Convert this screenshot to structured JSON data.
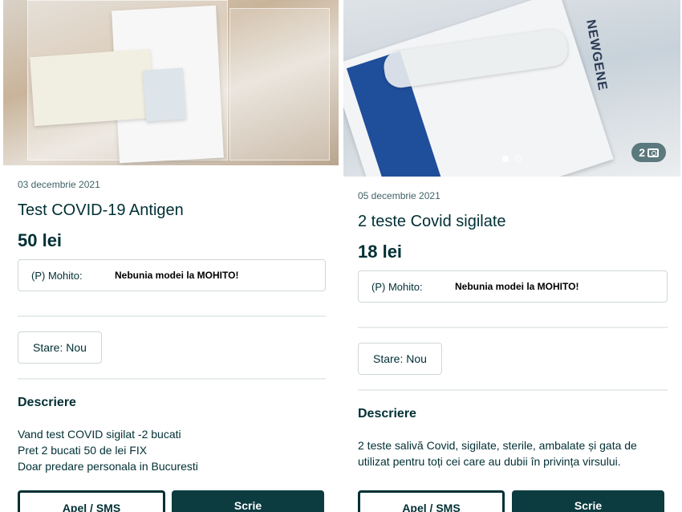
{
  "listings": [
    {
      "date": "03 decembrie 2021",
      "title": "Test COVID-19 Antigen",
      "price": "50 lei",
      "promo": {
        "label": "(P) Mohito:",
        "text": "Nebunia modei la MOHITO!"
      },
      "condition": "Stare: Nou",
      "description_title": "Descriere",
      "description_lines": [
        "Vand test COVID sigilat -2 bucati",
        "Pret 2 bucati 50 de lei FIX",
        "Doar predare personala in Bucuresti"
      ],
      "buttons": {
        "call": "Apel / SMS",
        "chat": "Scrie"
      }
    },
    {
      "date": "05 decembrie 2021",
      "title": "2 teste Covid sigilate",
      "price": "18 lei",
      "promo": {
        "label": "(P) Mohito:",
        "text": "Nebunia modei la MOHITO!"
      },
      "condition": "Stare: Nou",
      "description_title": "Descriere",
      "description_lines": [
        "2 teste salivă Covid, sigilate, sterile, ambalate și gata de",
        "utilizat pentru toți cei care au dubii în privința virsului."
      ],
      "photo_count": "2",
      "photo_brand_text": "NEWGENE",
      "buttons": {
        "call": "Apel / SMS",
        "chat": "Scrie"
      }
    }
  ],
  "colors": {
    "text": "#002f34",
    "button_dark": "#0c3b40",
    "border": "#ced6d7"
  },
  "icons": [
    "camera-icon"
  ]
}
